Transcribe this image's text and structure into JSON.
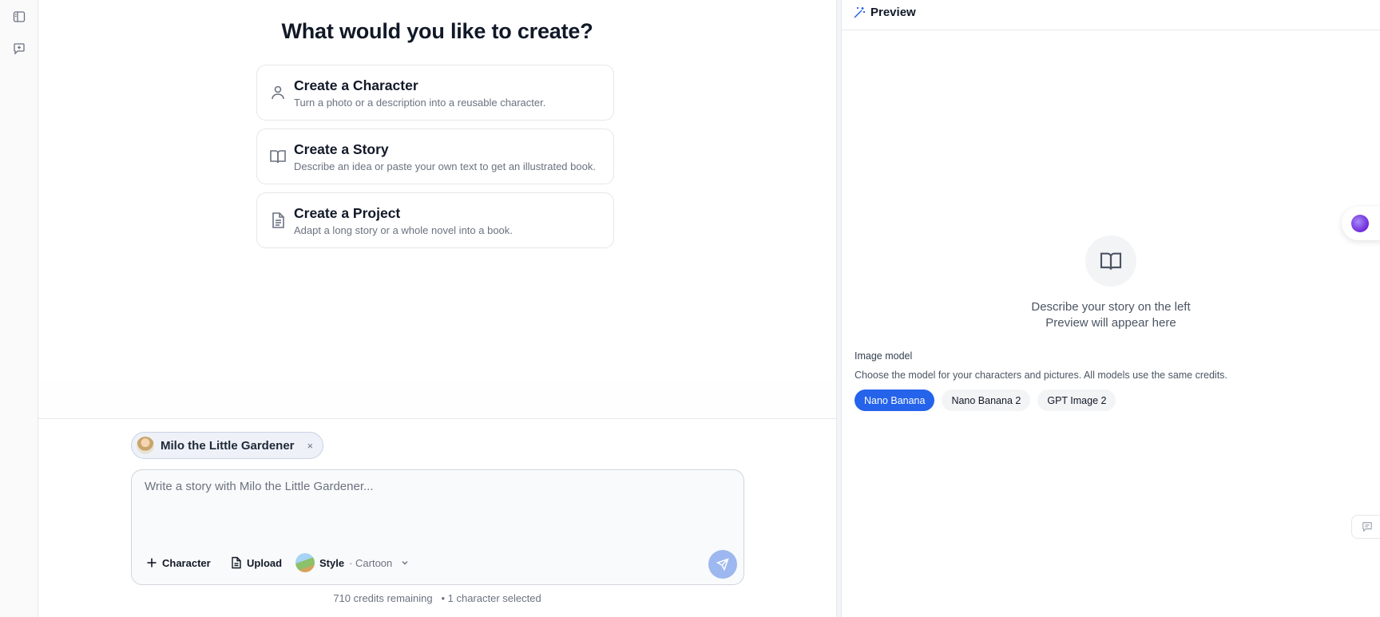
{
  "main": {
    "heading": "What would you like to create?",
    "cards": [
      {
        "title": "Create a Character",
        "desc": "Turn a photo or a description into a reusable character.",
        "icon": "person-icon"
      },
      {
        "title": "Create a Story",
        "desc": "Describe an idea or paste your own text to get an illustrated book.",
        "icon": "book-open-icon"
      },
      {
        "title": "Create a Project",
        "desc": "Adapt a long story or a whole novel into a book.",
        "icon": "document-icon"
      }
    ]
  },
  "composer": {
    "chip_label": "Milo the Little Gardener",
    "chip_close": "×",
    "placeholder": "Write a story with Milo the Little Gardener...",
    "character_label": "Character",
    "upload_label": "Upload",
    "style_label": "Style",
    "style_value": "· Cartoon",
    "credits": "710 credits remaining",
    "selection": "• 1 character selected"
  },
  "preview": {
    "title": "Preview",
    "empty_line1": "Describe your story on the left",
    "empty_line2": "Preview will appear here",
    "model_label": "Image model",
    "model_desc": "Choose the model for your characters and pictures. All models use the same credits.",
    "models": [
      "Nano Banana",
      "Nano Banana 2",
      "GPT Image 2"
    ],
    "selected_model": "Nano Banana"
  },
  "colors": {
    "accent": "#2563eb",
    "send_button": "#9db8f0"
  }
}
